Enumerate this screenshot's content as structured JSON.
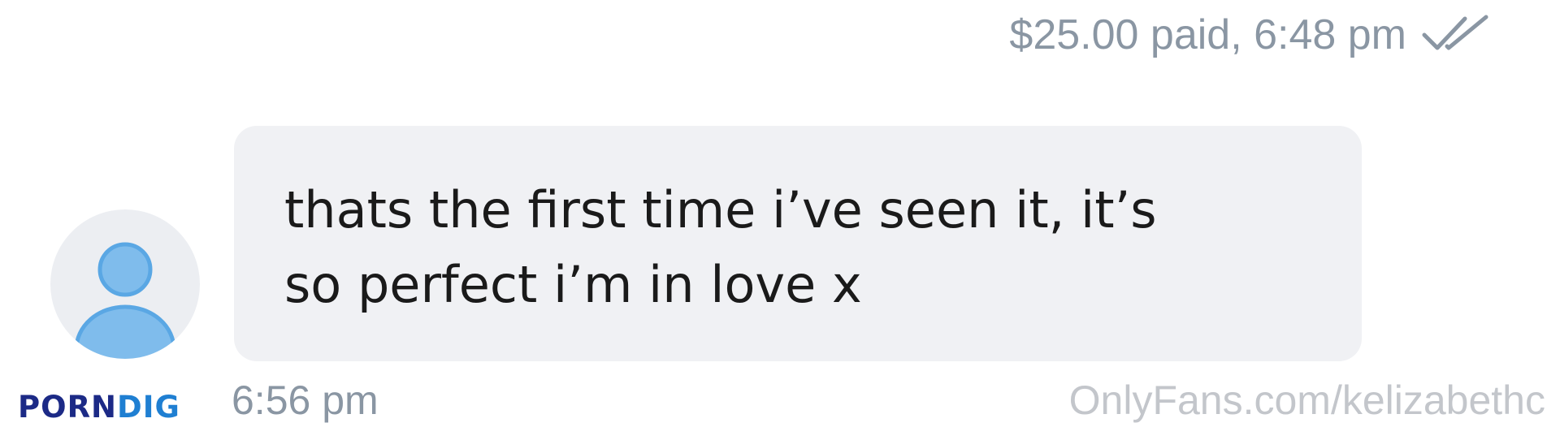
{
  "message_meta": {
    "paid_status": "$25.00 paid, 6:48 pm",
    "read_icon": "double-check-icon"
  },
  "incoming_message": {
    "avatar_icon": "default-user-avatar-icon",
    "text_line_1": "thats the first time i’ve seen it, it’s",
    "text_line_2": "so perfect i’m in love x",
    "time": "6:56 pm"
  },
  "watermark": {
    "text": "OnlyFans.com/kelizabethc"
  },
  "logo": {
    "part_1": "PORN",
    "part_2": "DIG"
  },
  "colors": {
    "meta_text": "#8a96a3",
    "bubble_bg": "#f0f1f4",
    "avatar_accent": "#78b8ea",
    "logo_dark": "#1c2a86",
    "logo_light": "#1f7fd2"
  }
}
